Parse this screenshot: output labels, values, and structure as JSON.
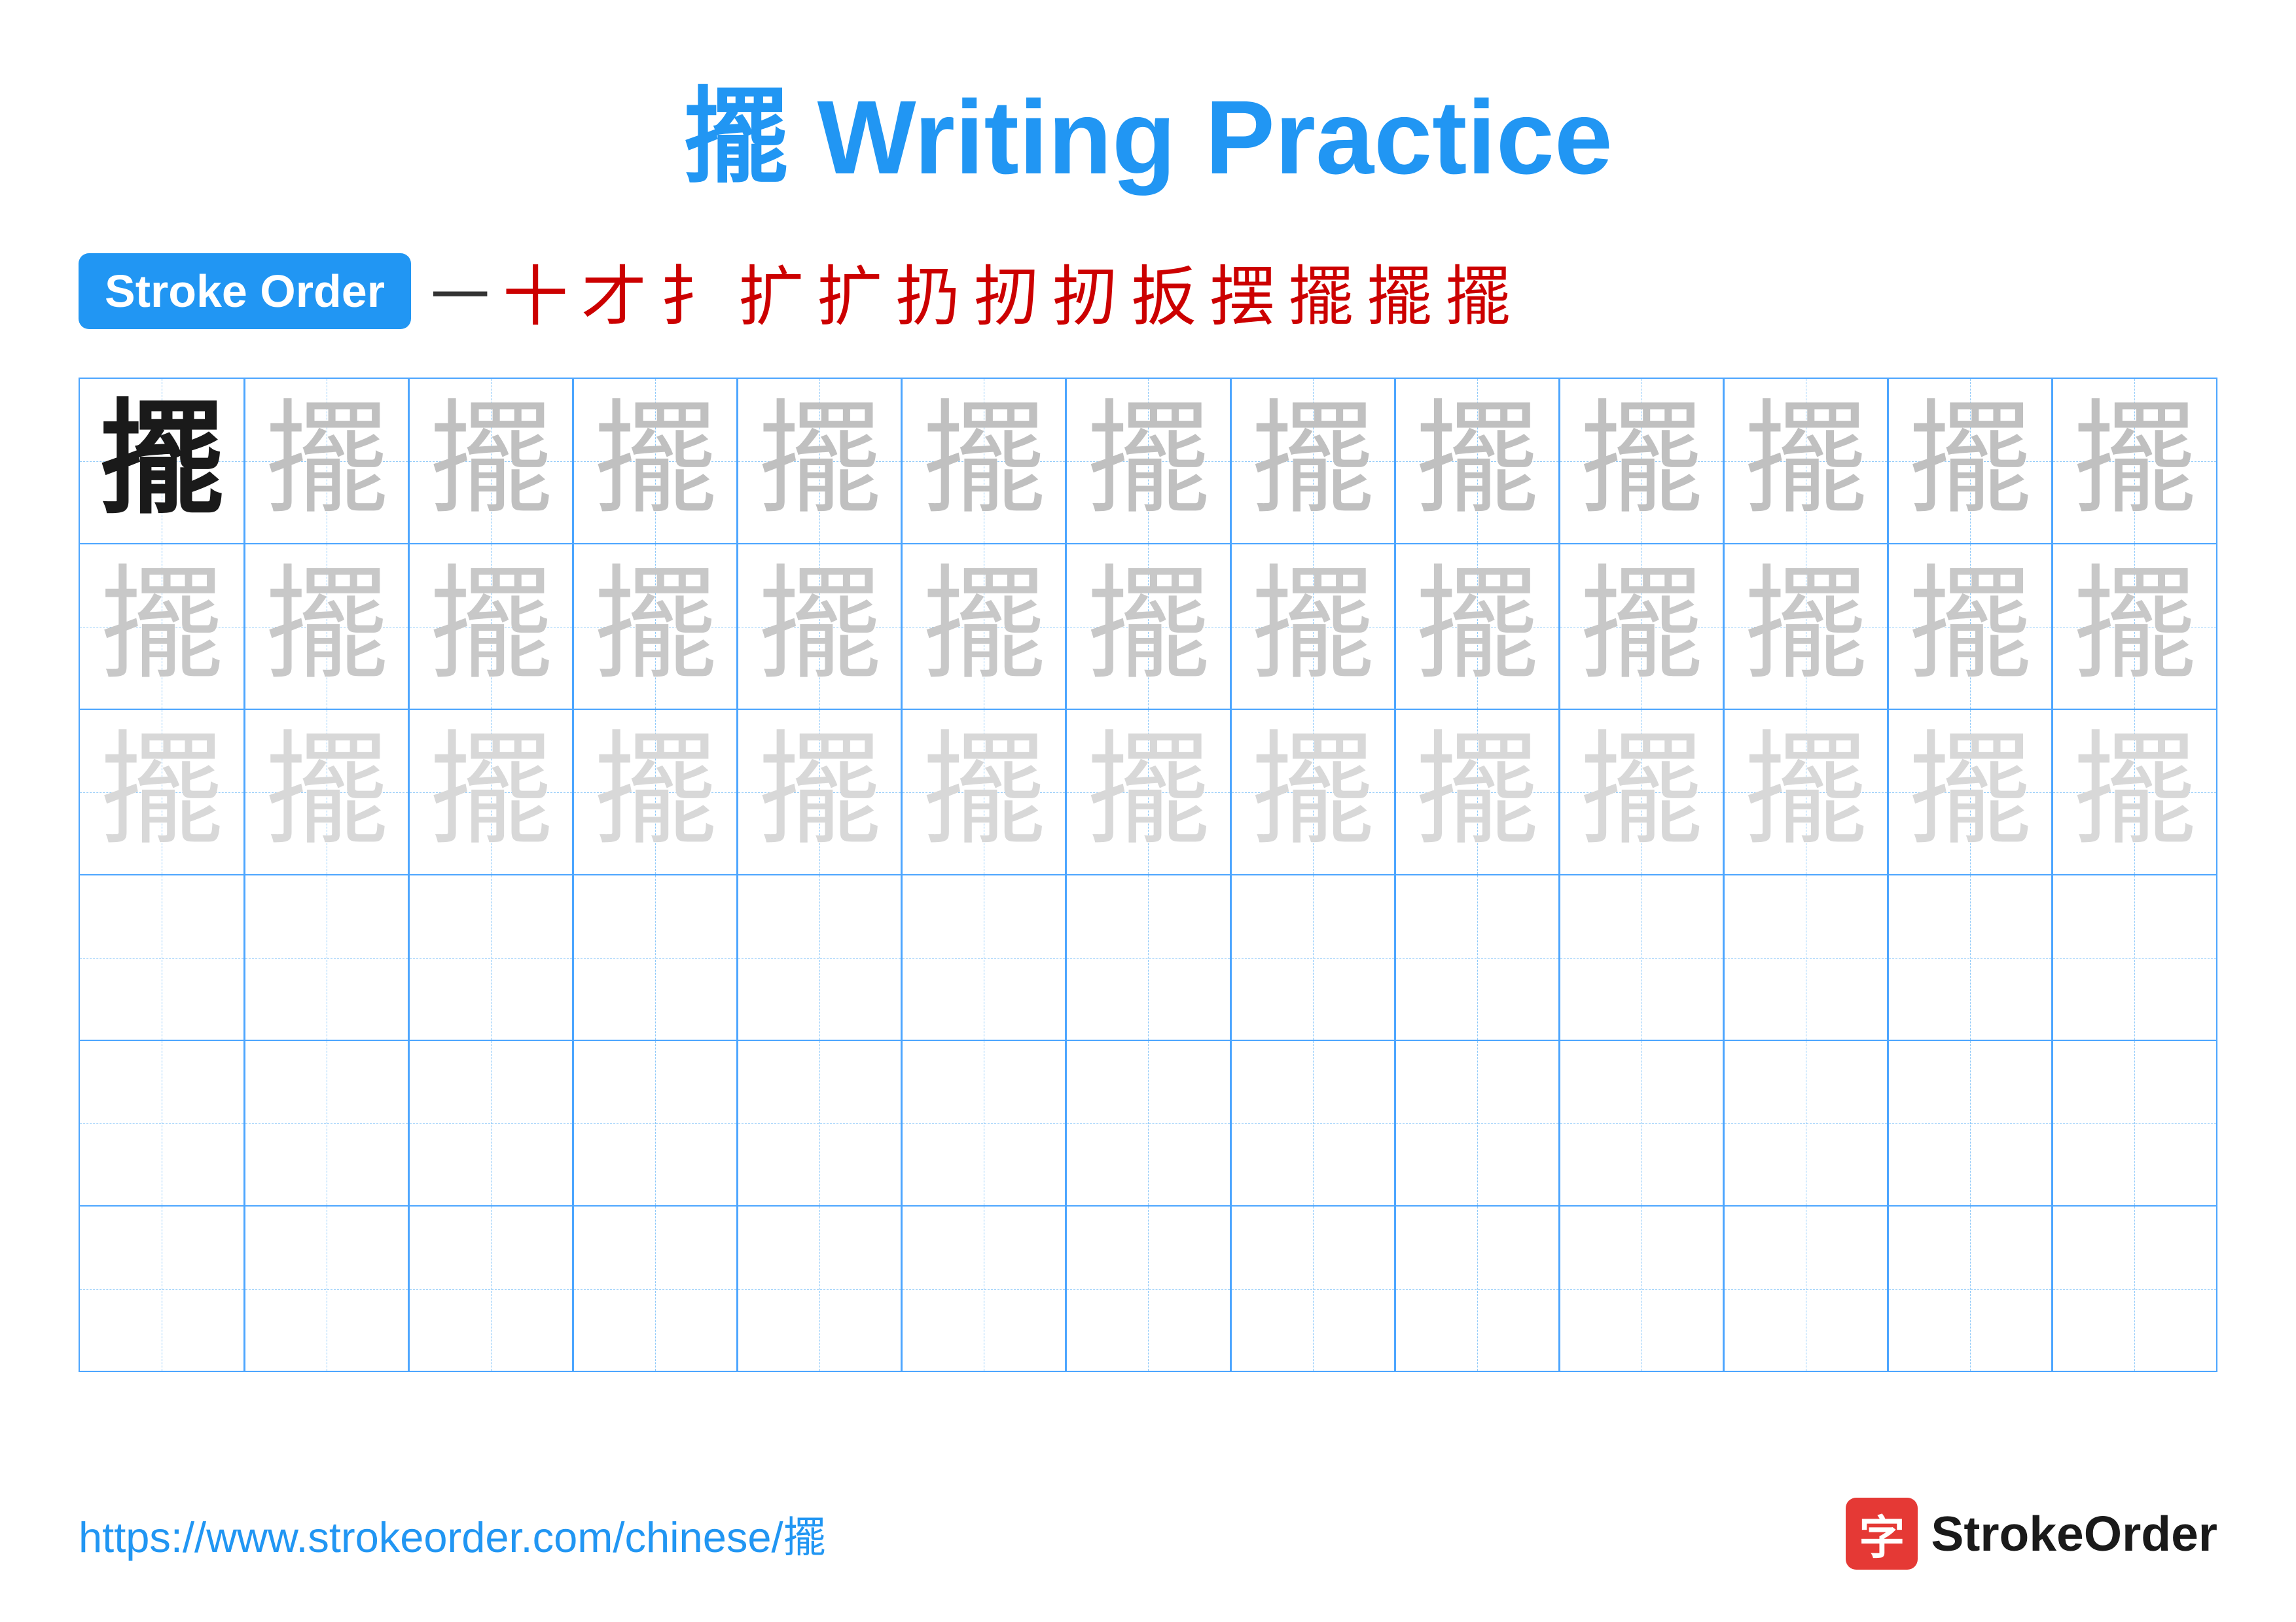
{
  "title": "擺 Writing Practice",
  "stroke_order": {
    "badge_label": "Stroke Order",
    "strokes": [
      "一",
      "十",
      "才",
      "扌",
      "扩",
      "扩",
      "扔",
      "扨",
      "扨",
      "扳",
      "摆",
      "擺",
      "擺",
      "擺"
    ]
  },
  "character": "擺",
  "grid": {
    "rows": 6,
    "cols": 13,
    "row_types": [
      "dark",
      "medium",
      "light",
      "empty",
      "empty",
      "empty"
    ]
  },
  "footer": {
    "url": "https://www.strokeorder.com/chinese/擺",
    "logo_char": "字",
    "logo_text": "StrokeOrder"
  }
}
